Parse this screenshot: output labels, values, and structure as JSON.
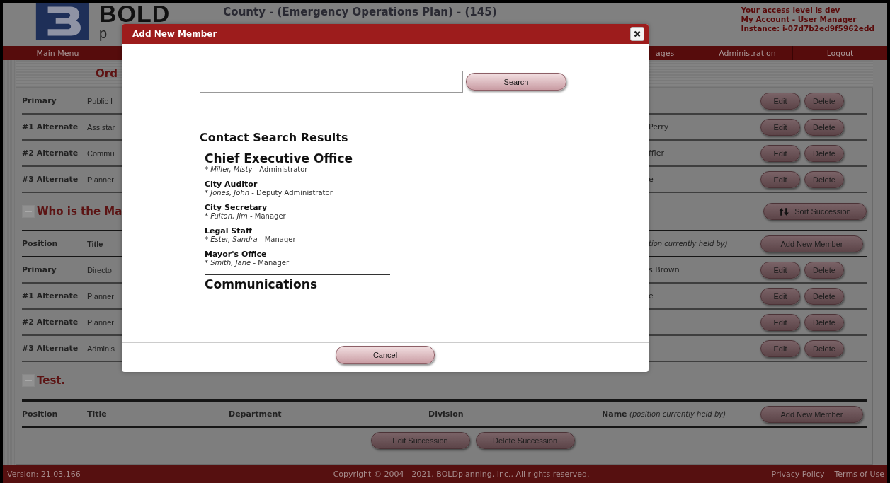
{
  "header": {
    "logo_text": "BOLD",
    "logo_subtext": "p",
    "title": "County - (Emergency Operations Plan) - (145)",
    "account_lines": [
      "Your access level is dev",
      "My Account - User Manager",
      "Instance: i-07d7b2ed9f5962edd"
    ]
  },
  "nav": [
    {
      "label": "Main Menu"
    },
    {
      "label": "ages"
    },
    {
      "label": "Administration"
    },
    {
      "label": "Logout"
    }
  ],
  "page_heading": "Ord",
  "sections": [
    {
      "rows": [
        {
          "position": "Primary",
          "title": "Public I",
          "edit": "Edit",
          "delete": "Delete"
        },
        {
          "position": "#1 Alternate",
          "title": "Assistar",
          "name": "Perry",
          "edit": "Edit",
          "delete": "Delete"
        },
        {
          "position": "#2 Alternate",
          "title": "Commu",
          "name": "ffler",
          "edit": "Edit",
          "delete": "Delete"
        },
        {
          "position": "#3 Alternate",
          "title": "Planner",
          "name": "e",
          "edit": "Edit",
          "delete": "Delete"
        }
      ]
    },
    {
      "title": "Who is the Ma",
      "sort_button": "Sort Succession",
      "header": {
        "position": "Position",
        "title": "Title",
        "name_note": "tion currently held by)",
        "add_button": "Add New Member"
      },
      "rows": [
        {
          "position": "Primary",
          "title": "Directo",
          "name": "s Brown",
          "edit": "Edit",
          "delete": "Delete"
        },
        {
          "position": "#1 Alternate",
          "title": "Planner",
          "name": "e",
          "edit": "Edit",
          "delete": "Delete"
        },
        {
          "position": "#2 Alternate",
          "title": "Planner",
          "edit": "Edit",
          "delete": "Delete"
        },
        {
          "position": "#3 Alternate",
          "title": "Adminis",
          "edit": "Edit",
          "delete": "Delete"
        }
      ]
    },
    {
      "title": "Test.",
      "header": {
        "position": "Position",
        "title": "Title",
        "department": "Department",
        "division": "Division",
        "name": "Name",
        "name_note": "(position currently held by)",
        "add_button": "Add New Member"
      },
      "actions": [
        "Edit Succession",
        "Delete Succession"
      ]
    }
  ],
  "footer": {
    "version": "Version: 21.03.166",
    "copyright": "Copyright © 2004 - 2021, BOLDplanning, Inc., All rights reserved.",
    "links": [
      "Privacy Policy",
      "Terms of Use"
    ]
  },
  "modal": {
    "title": "Add New Member",
    "search_button": "Search",
    "results_heading": "Contact Search Results",
    "groups": [
      {
        "name": "Chief Executive Office",
        "members": [
          {
            "person": "* *Miller, Misty* - Administrator"
          },
          {
            "title": "City Auditor",
            "person": "* *Jones, John* - Deputy Administrator"
          },
          {
            "title": "City Secretary",
            "person": "* *Fulton, Jim* - Manager"
          },
          {
            "title": "Legal Staff",
            "person": "* *Ester, Sandra* - Manager"
          },
          {
            "title": "Mayor's Office",
            "person": "* *Smith, Jane* - Manager"
          }
        ]
      },
      {
        "name": "Communications"
      }
    ],
    "cancel_button": "Cancel"
  }
}
